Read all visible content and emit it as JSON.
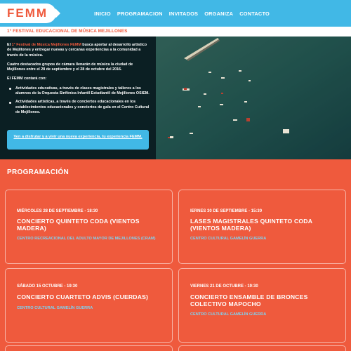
{
  "site": {
    "logo_text": "FEMM",
    "subtitle": "1° FESTIVAL EDUCACIONAL DE MÚSICA MEJILLONES"
  },
  "nav": {
    "items": [
      "INICIO",
      "PROGRAMACION",
      "INVITADOS",
      "ORGANIZA",
      "CONTACTO"
    ]
  },
  "hero": {
    "intro_prefix": "El ",
    "intro_highlight": "1° Festival de Música Mejillones FEMM",
    "intro_suffix": " busca aportar al desarrollo artístico de Mejillones y entregar nuevas y cercanas experiencias a la comunidad a través de la música.",
    "paragraph2": "Cuatro destacados grupos de cámara llenarán de música la ciudad de Mejillones entre el 28 de septiembre y el 28 de octubre del 2016.",
    "paragraph3": "El FEMM contará con:",
    "bullets": [
      "Actividades educativas, a través de clases magistrales y talleres a los alumnos de la Orquesta Sinfónica Infantil Estudiantil de Mejillones OSIEM.",
      "Actividades artísticas, a través de conciertos educacionales en los establecimientos educacionales y conciertos de gala en el Centro Cultural de Mejillones."
    ],
    "cta_label": "Ven a disfrutar y a vivir una nueva experiencia, tu experiencia FEMM."
  },
  "programacion": {
    "heading": "PROGRAMACIÓN",
    "events": [
      {
        "date": "MIÉRCOLES 28 DE SEPTIEMBRE - 18:30",
        "title": "CONCIERTO QUINTETO CODA (VIENTOS MADERA)",
        "venue": "CENTRO RECREACIONAL DEL ADULTO MAYOR DE MEJILLONES (CRAM)"
      },
      {
        "date": "IERNES 30 DE SEPTIEMBRE - 15:30",
        "title": "LASES MAGISTRALES QUINTETO CODA (VIENTOS MADERA)",
        "venue": "CENTRO CULTURAL GAMELÍN GUERRA"
      },
      {
        "date": "SÁBADO 15 OCTUBRE - 19:30",
        "title": "CONCIERTO CUARTETO ADVIS (CUERDAS)",
        "venue": "CENTRO CULTURAL GAMELÍN GUERRA"
      },
      {
        "date": "VIERNES 21 DE OCTUBRE - 19:30",
        "title": "CONCIERTO ENSAMBLE DE BRONCES COLECTIVO MAPOCHO",
        "venue": "CENTRO CULTURAL GAMELÍN GUERRA"
      }
    ]
  },
  "colors": {
    "brand_orange": "#ef5a3d",
    "brand_blue": "#41b8e6",
    "venue_blue": "#7fd3f2",
    "hero_dark": "#0b1f23"
  }
}
